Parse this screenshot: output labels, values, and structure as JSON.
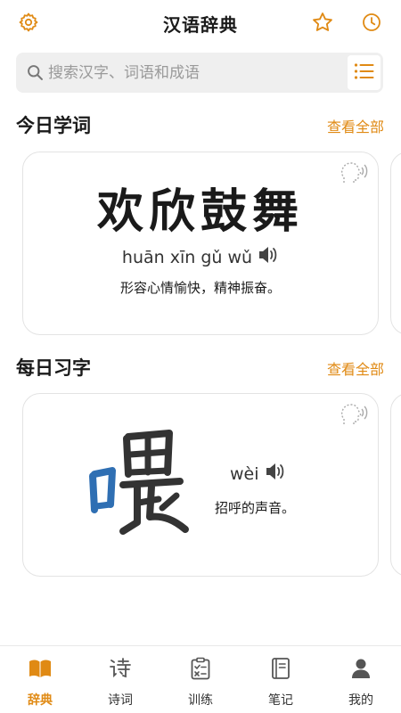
{
  "colors": {
    "accent": "#e08a14",
    "char_highlight": "#2f6fb3"
  },
  "header": {
    "title": "汉语辞典",
    "settings_icon": "gear-icon",
    "favorite_icon": "star-icon",
    "history_icon": "clock-icon"
  },
  "search": {
    "placeholder": "搜索汉字、词语和成语",
    "list_icon": "list-icon"
  },
  "word_section": {
    "title": "今日学词",
    "view_all": "查看全部",
    "word": "欢欣鼓舞",
    "pinyin": "huān xīn gǔ wǔ",
    "meaning": "形容心情愉快，精神振奋。"
  },
  "char_section": {
    "title": "每日习字",
    "view_all": "查看全部",
    "character": "喂",
    "pinyin": "wèi",
    "meaning": "招呼的声音。"
  },
  "nav": {
    "items": [
      {
        "label": "辞典",
        "icon": "book-icon",
        "active": true
      },
      {
        "label": "诗词",
        "icon": "poem-icon",
        "active": false
      },
      {
        "label": "训练",
        "icon": "clipboard-icon",
        "active": false
      },
      {
        "label": "笔记",
        "icon": "notebook-icon",
        "active": false
      },
      {
        "label": "我的",
        "icon": "user-icon",
        "active": false
      }
    ]
  }
}
